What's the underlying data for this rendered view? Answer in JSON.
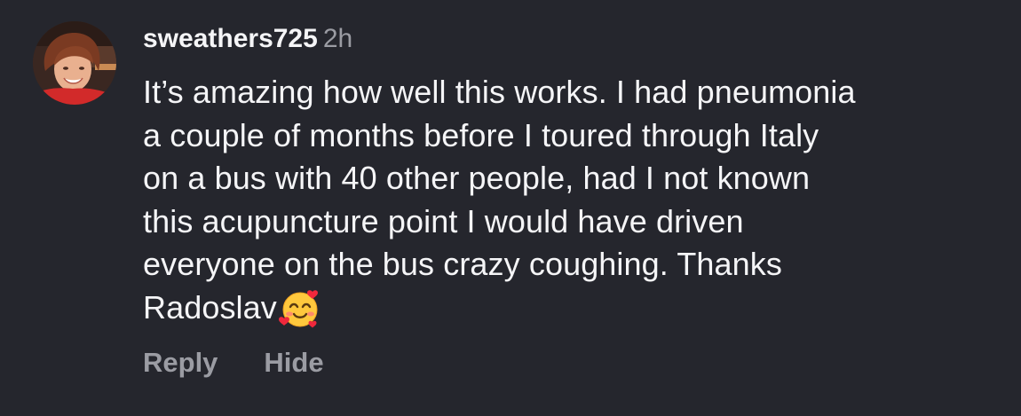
{
  "comment": {
    "username": "sweathers725",
    "timestamp": "2h",
    "text_lines": [
      "It’s amazing how well this works. I had pneumonia",
      "a couple of months before I toured through Italy",
      "on a bus with 40 other people, had I not known",
      "this acupuncture point I would have driven",
      "everyone on the bus crazy coughing. Thanks",
      "Radoslav"
    ],
    "emoji_icon": "smiling-face-with-hearts-icon",
    "avatar_icon": "user-profile-photo"
  },
  "actions": {
    "reply_label": "Reply",
    "hide_label": "Hide"
  },
  "colors": {
    "background": "#25262d",
    "primary_text": "#f5f5f7",
    "secondary_text": "#9b9ca3"
  }
}
